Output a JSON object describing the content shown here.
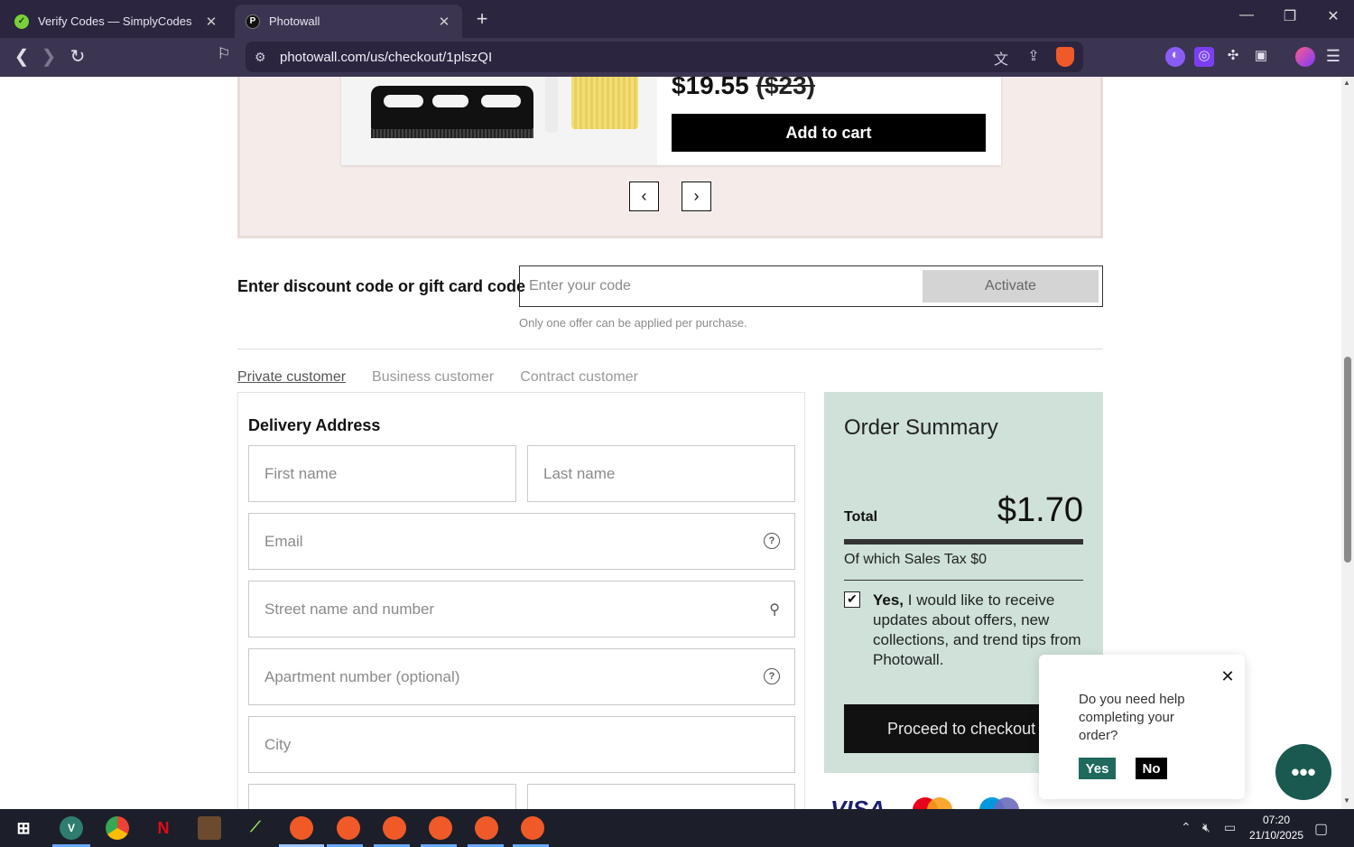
{
  "browser": {
    "tabs": [
      {
        "title": "Verify Codes — SimplyCodes",
        "icon": "simplycodes-icon"
      },
      {
        "title": "Photowall",
        "icon": "photowall-icon"
      }
    ],
    "url": "photowall.com/us/checkout/1plszQI"
  },
  "carousel": {
    "price": "$19.55",
    "old_price": "($23)",
    "add_to_cart": "Add to cart"
  },
  "discount": {
    "label": "Enter discount code or gift card code",
    "placeholder": "Enter your code",
    "button": "Activate",
    "note": "Only one offer can be applied per purchase."
  },
  "customer_tabs": [
    "Private customer",
    "Business customer",
    "Contract customer"
  ],
  "form": {
    "title": "Delivery Address",
    "first_name": "First name",
    "last_name": "Last name",
    "email": "Email",
    "street": "Street name and number",
    "apartment": "Apartment number (optional)",
    "city": "City"
  },
  "summary": {
    "title": "Order Summary",
    "total_label": "Total",
    "total_value": "$1.70",
    "tax": "Of which Sales Tax $0",
    "optin_bold": "Yes,",
    "optin_text": " I would like to receive updates about offers, new collections, and trend tips from Photowall.",
    "optin_checked": true,
    "proceed": "Proceed to checkout"
  },
  "payment": {
    "visa": "VISA"
  },
  "help_popup": {
    "question": "Do you need help completing your order?",
    "yes": "Yes",
    "no": "No"
  },
  "taskbar": {
    "time": "07:20",
    "date": "21/10/2025"
  },
  "colors": {
    "summary_bg": "#cfe1d9",
    "carousel_bg": "#f5ecea",
    "accent_green": "#1f6a5d"
  }
}
